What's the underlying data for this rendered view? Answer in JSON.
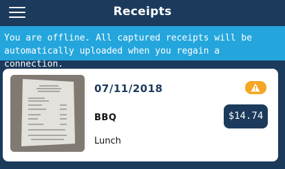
{
  "header": {
    "title": "Receipts",
    "menu_icon": "hamburger-menu-icon"
  },
  "banner": {
    "text": "You are offline. All captured receipts will be automatically uploaded when you regain a connection."
  },
  "receipt": {
    "date": "07/11/2018",
    "merchant": "BBQ",
    "amount": "$14.74",
    "category": "Lunch",
    "status_icon": "warning-icon"
  },
  "colors": {
    "navy": "#1b3a5c",
    "banner_blue": "#24a6dd",
    "warning_orange": "#f5a623"
  }
}
